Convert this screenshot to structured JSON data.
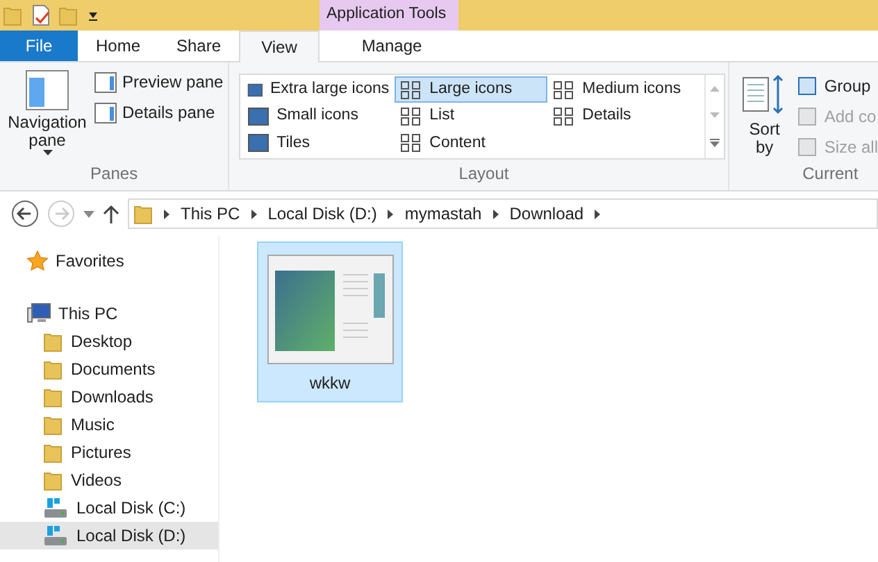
{
  "contextual_tab_group": {
    "title": "Application Tools"
  },
  "tabs": [
    {
      "label": "File",
      "kind": "file",
      "selected": false
    },
    {
      "label": "Home",
      "kind": "tab",
      "selected": false
    },
    {
      "label": "Share",
      "kind": "tab",
      "selected": false
    },
    {
      "label": "View",
      "kind": "tab",
      "selected": true
    },
    {
      "label": "Manage",
      "kind": "tab",
      "selected": false
    }
  ],
  "panes_group": {
    "label": "Panes",
    "navigation_pane": "Navigation pane",
    "items": [
      "Preview pane",
      "Details pane"
    ]
  },
  "layout_group": {
    "label": "Layout",
    "items": [
      {
        "label": "Extra large icons",
        "selected": false
      },
      {
        "label": "Large icons",
        "selected": true
      },
      {
        "label": "Medium icons",
        "selected": false
      },
      {
        "label": "Small icons",
        "selected": false
      },
      {
        "label": "List",
        "selected": false
      },
      {
        "label": "Details",
        "selected": false
      },
      {
        "label": "Tiles",
        "selected": false
      },
      {
        "label": "Content",
        "selected": false
      }
    ]
  },
  "current_view_group": {
    "label": "Current",
    "sort": "Sort by",
    "items": [
      {
        "label": "Group",
        "disabled": false
      },
      {
        "label": "Add co",
        "disabled": true
      },
      {
        "label": "Size all",
        "disabled": true
      }
    ]
  },
  "address_bar": {
    "path": [
      "This PC",
      "Local Disk (D:)",
      "mymastah",
      "Download"
    ]
  },
  "navigation": [
    {
      "label": "Favorites",
      "kind": "favorites",
      "selected": false
    },
    {
      "label": "This PC",
      "kind": "pc",
      "selected": false,
      "children": [
        {
          "label": "Desktop",
          "kind": "folder",
          "selected": false
        },
        {
          "label": "Documents",
          "kind": "folder",
          "selected": false
        },
        {
          "label": "Downloads",
          "kind": "folder",
          "selected": false
        },
        {
          "label": "Music",
          "kind": "folder",
          "selected": false
        },
        {
          "label": "Pictures",
          "kind": "folder",
          "selected": false
        },
        {
          "label": "Videos",
          "kind": "folder",
          "selected": false
        },
        {
          "label": "Local Disk (C:)",
          "kind": "drive",
          "selected": false
        },
        {
          "label": "Local Disk (D:)",
          "kind": "drive",
          "selected": true
        }
      ]
    }
  ],
  "files": [
    {
      "name": "wkkw",
      "selected": true
    }
  ]
}
